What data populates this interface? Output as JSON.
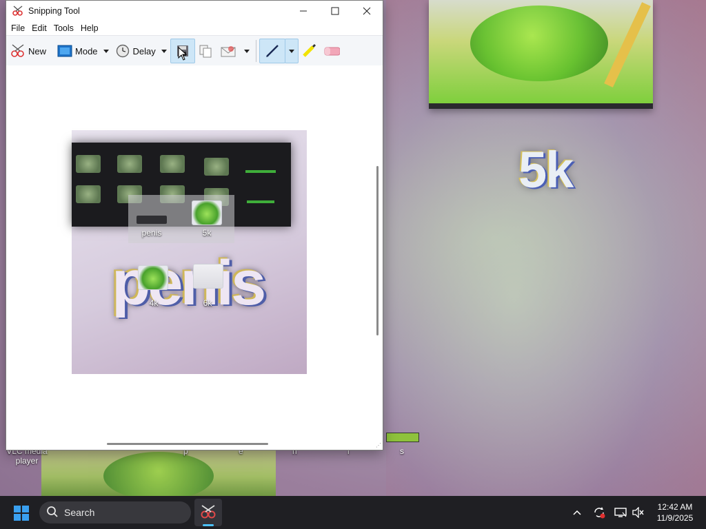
{
  "window": {
    "title": "Snipping Tool",
    "menu": [
      "File",
      "Edit",
      "Tools",
      "Help"
    ],
    "toolbar": {
      "new_label": "New",
      "mode_label": "Mode",
      "delay_label": "Delay"
    }
  },
  "snip_content": {
    "popup_labels": [
      "penis",
      "5k"
    ],
    "icon_labels": [
      "4k",
      "6k"
    ],
    "big_text": "penis"
  },
  "desktop": {
    "big_label": "5k",
    "vlc_label": "VLC media player",
    "row_labels": [
      "p",
      "e",
      "n",
      "i",
      "s"
    ]
  },
  "taskbar": {
    "search_placeholder": "Search",
    "time": "12:42 AM",
    "date": "11/9/2025"
  },
  "colors": {
    "accent": "#3aa0f0",
    "taskbar_bg": "#1f1f23",
    "selection": "#cde6f7"
  }
}
